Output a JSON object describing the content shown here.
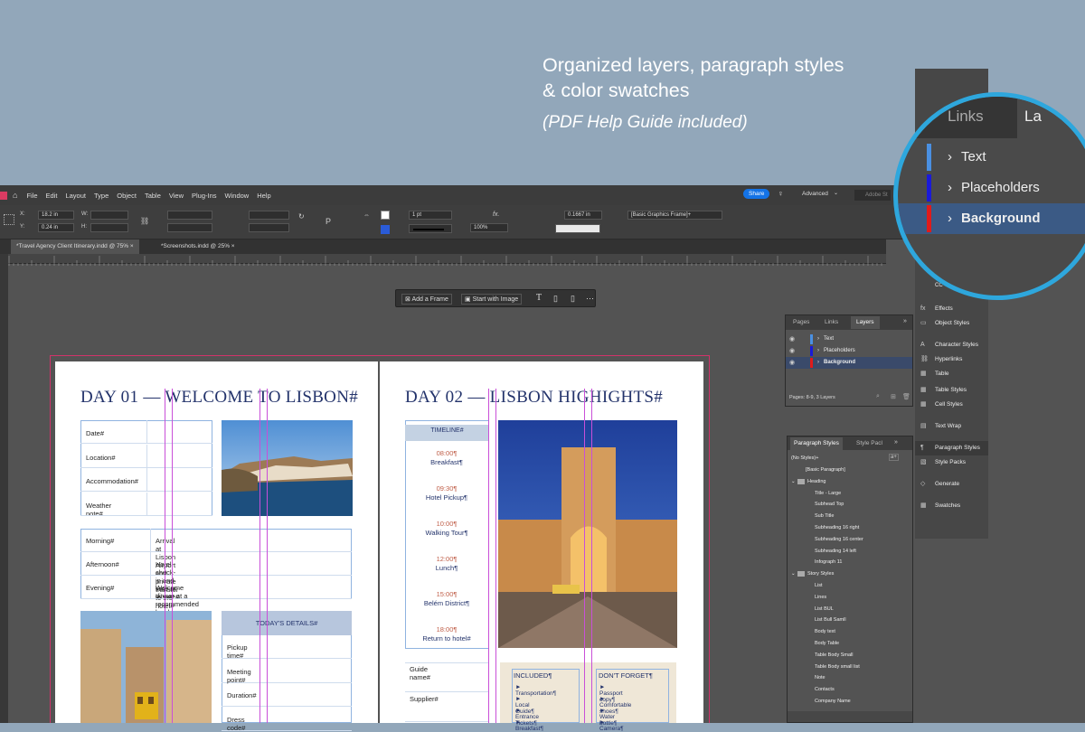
{
  "headline": {
    "line1": "Organized layers, paragraph styles",
    "line2": "& color swatches",
    "subtitle": "(PDF Help Guide included)"
  },
  "menu": [
    "File",
    "Edit",
    "Layout",
    "Type",
    "Object",
    "Table",
    "View",
    "Plug-Ins",
    "Window",
    "Help"
  ],
  "topright": {
    "share": "Share",
    "workspace": "Advanced",
    "search": "Adobe St"
  },
  "control": {
    "x": "18.2 in",
    "y": "0.24 in",
    "w": "W:",
    "h": "H:",
    "stroke": "1 pt",
    "zoom": "100%",
    "ref": "0.1667 in",
    "frame": "[Basic Graphics Frame]+"
  },
  "doc_tabs": [
    {
      "label": "*Travel Agency Client Itinerary.indd @ 75%"
    },
    {
      "label": "*Screenshots.indd @ 25%"
    }
  ],
  "context_bar": {
    "add_frame": "Add a Frame",
    "start_image": "Start with Image"
  },
  "left_page": {
    "title": "DAY 01 — WELCOME TO LISBON#",
    "info_rows": [
      "Date#",
      "Location#",
      "Accommodation#",
      "Weather note#"
    ],
    "schedule": [
      {
        "label": "Morning#",
        "text": "Arrival at Lisbon Airport and private transfer to the hotel#"
      },
      {
        "label": "Afternoon#",
        "text": "Hotel check-in and time at leisure#"
      },
      {
        "label": "Evening#",
        "text": "Welcome dinner at a recommended local restaurant#"
      }
    ],
    "details_header": "TODAY'S DETAILS#",
    "details": [
      "Pickup time#",
      "Meeting point#",
      "Duration#",
      "Dress code#"
    ]
  },
  "right_page": {
    "title": "DAY 02 — LISBON HIGHIGHTS#",
    "timeline_header": "TIMELINE#",
    "timeline": [
      {
        "time": "08:00¶",
        "event": "Breakfast¶"
      },
      {
        "time": "09:30¶",
        "event": "Hotel Pickup¶"
      },
      {
        "time": "10:00¶",
        "event": "Walking Tour¶"
      },
      {
        "time": "12:00¶",
        "event": "Lunch¶"
      },
      {
        "time": "15:00¶",
        "event": "Belém District¶"
      },
      {
        "time": "18:00¶",
        "event": "Return to hotel#"
      }
    ],
    "fields": [
      "Guide name#",
      "Supplier#"
    ],
    "included_title": "INCLUDED¶",
    "included": [
      "► Transportation¶",
      "► Local Guide¶",
      "► Entrance Tickets¶",
      "► Breakfast¶"
    ],
    "forget_title": "DON'T FORGET¶",
    "forget": [
      "► Passport copy¶",
      "► Comfortable shoes¶",
      "► Water bottle¶",
      "► Camera¶"
    ]
  },
  "layers_panel": {
    "tabs": [
      "Pages",
      "Links",
      "Layers"
    ],
    "layers": [
      {
        "name": "Text",
        "color": "#4a90e2"
      },
      {
        "name": "Placeholders",
        "color": "#1a1ad8"
      },
      {
        "name": "Background",
        "color": "#e01b1b"
      }
    ],
    "status": "Pages: 8-9, 3 Layers"
  },
  "paragraph_panel": {
    "tabs": [
      "Paragraph Styles",
      "Style Pacl"
    ],
    "current": "(No Styles)+",
    "items": [
      {
        "label": "[Basic Paragraph]",
        "indent": 1
      },
      {
        "label": "Heading",
        "indent": 0,
        "folder": true
      },
      {
        "label": "Title - Large",
        "indent": 2
      },
      {
        "label": "Subhead Top",
        "indent": 2
      },
      {
        "label": "Sub Title",
        "indent": 2
      },
      {
        "label": "Subheading 16 right",
        "indent": 2
      },
      {
        "label": "Subheading 16 center",
        "indent": 2
      },
      {
        "label": "Subheading 14 left",
        "indent": 2
      },
      {
        "label": "Infograph 11",
        "indent": 2
      },
      {
        "label": "Story Styles",
        "indent": 0,
        "folder": true
      },
      {
        "label": "List",
        "indent": 2
      },
      {
        "label": "Lines",
        "indent": 2
      },
      {
        "label": "List BUL",
        "indent": 2
      },
      {
        "label": "List Bull Samll",
        "indent": 2
      },
      {
        "label": "Body text",
        "indent": 2
      },
      {
        "label": "Body Table",
        "indent": 2
      },
      {
        "label": "Table Body Small",
        "indent": 2
      },
      {
        "label": "Table Body small list",
        "indent": 2
      },
      {
        "label": "Note",
        "indent": 2
      },
      {
        "label": "Contacts",
        "indent": 2
      },
      {
        "label": "Company Name",
        "indent": 2
      }
    ]
  },
  "right_panels": [
    "Effects",
    "Object Styles",
    "Character Styles",
    "Hyperlinks",
    "Table",
    "Table Styles",
    "Cell Styles",
    "Text Wrap",
    "Paragraph Styles",
    "Style Packs",
    "Generate",
    "Swatches"
  ],
  "right_panels_top": "CC",
  "magnifier": {
    "tabs": [
      "Links",
      "La"
    ],
    "layers": [
      {
        "name": "Text",
        "color": "#4a90e2"
      },
      {
        "name": "Placeholders",
        "color": "#1a1ad8"
      },
      {
        "name": "Background",
        "color": "#e01b1b"
      }
    ]
  }
}
